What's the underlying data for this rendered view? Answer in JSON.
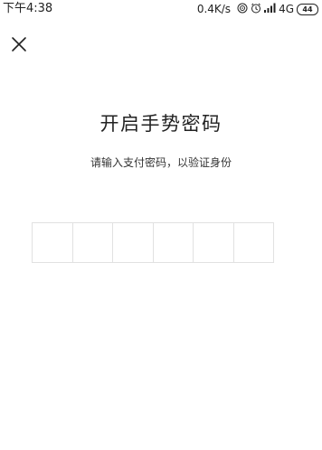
{
  "status_bar": {
    "time": "下午4:38",
    "net_speed": "0.4K/s",
    "net_type": "4G",
    "battery": "44",
    "icons": [
      "hotspot-icon",
      "alarm-icon",
      "signal-icon",
      "battery-icon"
    ]
  },
  "header": {
    "close_icon": "close-icon"
  },
  "main": {
    "title": "开启手势密码",
    "subtitle": "请输入支付密码，以验证身份",
    "pin_length": 6
  },
  "colors": {
    "background": "#ffffff",
    "text": "#222222",
    "cell_border": "#e1e1e1"
  }
}
